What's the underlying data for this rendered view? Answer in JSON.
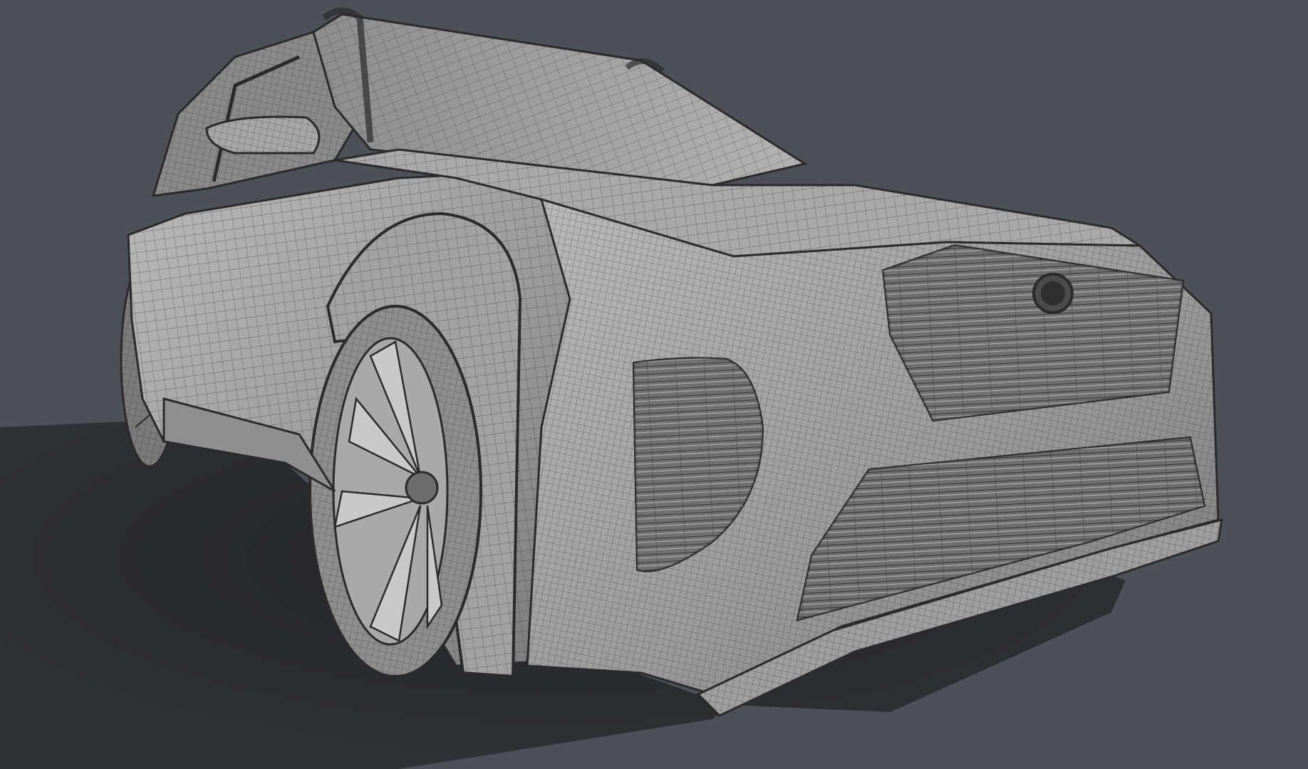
{
  "scene": {
    "subject": "wireframe-car-render",
    "colors": {
      "background": "#4c5057",
      "floor_shadow": "#2a2c31",
      "body_fill": "#9b9b9b",
      "body_light": "#b9b9b9",
      "body_dark": "#6f6f70",
      "wire": "#2b2b2d",
      "grille_fill": "#7d7d7e",
      "tire": "#8e8e8e"
    }
  }
}
